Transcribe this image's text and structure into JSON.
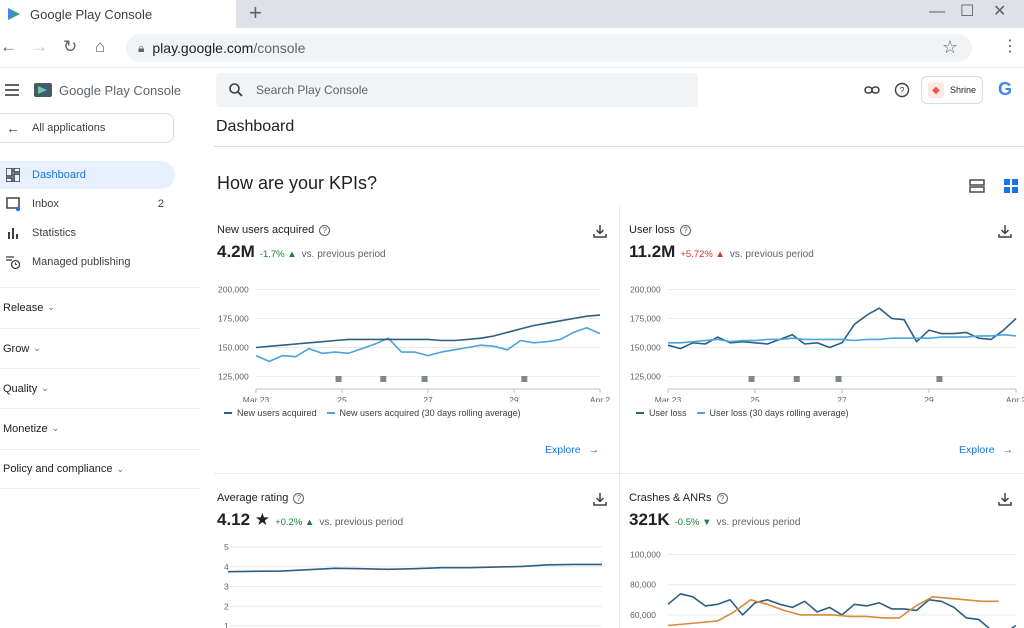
{
  "browser": {
    "tab_title": "Google Play Console",
    "new_tab": "+",
    "url_host": "play.google.com",
    "url_path": "/console"
  },
  "sidebar": {
    "brand": "Google Play Console",
    "all_applications": "All applications",
    "items": [
      {
        "label": "Dashboard",
        "icon": "dashboard-icon",
        "active": true
      },
      {
        "label": "Inbox",
        "icon": "inbox-icon",
        "count": "2"
      },
      {
        "label": "Statistics",
        "icon": "bar-chart-icon"
      },
      {
        "label": "Managed publishing",
        "icon": "schedule-icon"
      }
    ],
    "sections": [
      "Release",
      "Grow",
      "Quality",
      "Monetize",
      "Policy and compliance"
    ]
  },
  "topbar": {
    "search_placeholder": "Search Play Console",
    "app_name": "Shrine"
  },
  "page": {
    "title": "Dashboard",
    "kpi_heading": "How are your KPIs?"
  },
  "colors": {
    "accent": "#1a73e8",
    "series_dark": "#2c5f86",
    "series_light": "#4ca3dd",
    "series_orange": "#d98a3a",
    "good": "#188038",
    "bad": "#d93025"
  },
  "cards": [
    {
      "title": "New users acquired",
      "value": "4.2M",
      "delta": "-1.7% ▲",
      "vs": "vs. previous period",
      "explore": "Explore",
      "legend": [
        "New users acquired",
        "New users acquired (30 days rolling average)"
      ]
    },
    {
      "title": "User loss",
      "value": "11.2M",
      "delta": "+5.72% ▲",
      "vs": "vs. previous period",
      "explore": "Explore",
      "legend": [
        "User loss",
        "User loss (30 days rolling average)"
      ]
    },
    {
      "title": "Average rating",
      "value": "4.12 ★",
      "delta": "+0.2% ▲",
      "vs": "vs. previous period"
    },
    {
      "title": "Crashes & ANRs",
      "value": "321K",
      "delta": "-0.5% ▼",
      "vs": "vs. previous period"
    }
  ],
  "chart_data": [
    {
      "type": "line",
      "x": [
        "Mar 23",
        "",
        "25",
        "",
        "27",
        "",
        "29",
        "",
        "Apr 2"
      ],
      "xticks": [
        "Mar 23",
        "25",
        "27",
        "29",
        "Apr 2"
      ],
      "yticks": [
        "200,000",
        "175,000",
        "150,000",
        "125,000"
      ],
      "ylim": [
        115000,
        210000
      ],
      "series": [
        {
          "name": "New users acquired (30 days rolling average)",
          "values": [
            143000,
            138000,
            143000,
            142000,
            149000,
            145000,
            146000,
            145000,
            149000,
            153000,
            158000,
            146000,
            146000,
            143000,
            146000,
            148000,
            150000,
            152000,
            151000,
            148000,
            156000,
            154000,
            155000,
            157000,
            163000,
            167000,
            162000
          ]
        },
        {
          "name": "New users acquired",
          "values": [
            150000,
            151000,
            152000,
            153000,
            154000,
            155000,
            156000,
            157000,
            157000,
            157000,
            157000,
            157000,
            157000,
            157000,
            156000,
            156000,
            157000,
            158000,
            160000,
            163000,
            166000,
            169000,
            171000,
            173000,
            175000,
            177000,
            178000
          ]
        }
      ]
    },
    {
      "type": "line",
      "x": [
        "Mar 23",
        "",
        "25",
        "",
        "27",
        "",
        "29",
        "",
        "Apr 2"
      ],
      "xticks": [
        "Mar 23",
        "25",
        "27",
        "29",
        "Apr 2"
      ],
      "yticks": [
        "200,000",
        "175,000",
        "150,000",
        "125,000"
      ],
      "ylim": [
        115000,
        210000
      ],
      "series": [
        {
          "name": "User loss",
          "values": [
            152000,
            149000,
            154000,
            153000,
            159000,
            154000,
            155000,
            154000,
            153000,
            157000,
            161000,
            153000,
            154000,
            150000,
            154000,
            170000,
            178000,
            184000,
            175000,
            174000,
            155000,
            165000,
            162000,
            162000,
            163000,
            158000,
            157000,
            165000,
            175000
          ]
        },
        {
          "name": "User loss (30 days rolling average)",
          "values": [
            154000,
            154000,
            155000,
            156000,
            157000,
            155000,
            156000,
            156000,
            157000,
            157000,
            158000,
            157000,
            157000,
            157000,
            157000,
            156000,
            157000,
            157000,
            158000,
            158000,
            158000,
            158000,
            159000,
            159000,
            159000,
            160000,
            160000,
            161000,
            160000
          ]
        }
      ]
    },
    {
      "type": "line",
      "yticks": [
        "5",
        "4",
        "3",
        "2",
        "1"
      ],
      "ylim": [
        1,
        5
      ],
      "series": [
        {
          "name": "Average rating",
          "values": [
            3.75,
            3.77,
            3.78,
            3.85,
            3.92,
            3.9,
            3.87,
            3.9,
            3.95,
            3.95,
            3.98,
            4.02,
            4.1,
            4.12,
            4.12
          ]
        }
      ]
    },
    {
      "type": "line",
      "yticks": [
        "100,000",
        "80,000",
        "60,000"
      ],
      "ylim": [
        50000,
        105000
      ],
      "series": [
        {
          "name": "Crashes & ANRs",
          "values": [
            67000,
            74000,
            72000,
            66000,
            67000,
            70000,
            60000,
            68000,
            70000,
            67000,
            65000,
            69000,
            62000,
            65000,
            60000,
            67000,
            66000,
            68000,
            64000,
            64000,
            63000,
            70000,
            69000,
            65000,
            58000,
            57000,
            50000,
            48000,
            53000
          ]
        },
        {
          "name": "Crashes & ANRs (30 days rolling average)",
          "values": [
            53000,
            54000,
            55000,
            56000,
            62000,
            70000,
            67000,
            63000,
            60000,
            60000,
            60000,
            59000,
            59000,
            58000,
            58000,
            66000,
            72000,
            71000,
            70000,
            69000,
            69000
          ]
        }
      ]
    }
  ]
}
